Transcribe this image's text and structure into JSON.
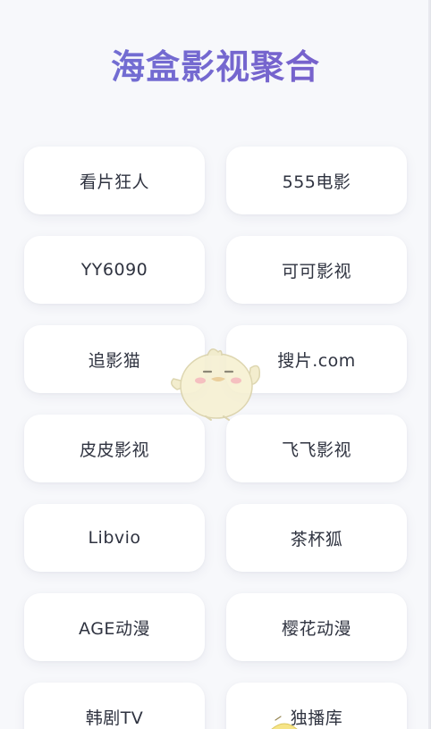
{
  "header": {
    "title": "海盒影视聚合"
  },
  "sites": [
    {
      "label": "看片狂人"
    },
    {
      "label": "555电影"
    },
    {
      "label": "YY6090"
    },
    {
      "label": "可可影视"
    },
    {
      "label": "追影猫"
    },
    {
      "label": "搜片.com"
    },
    {
      "label": "皮皮影视"
    },
    {
      "label": "飞飞影视"
    },
    {
      "label": "Libvio"
    },
    {
      "label": "茶杯狐"
    },
    {
      "label": "AGE动漫"
    },
    {
      "label": "樱花动漫"
    },
    {
      "label": "韩剧TV"
    },
    {
      "label": "独播库"
    }
  ],
  "colors": {
    "title_gradient_start": "#6f73d6",
    "title_gradient_end": "#7a5cc9",
    "card_background": "#ffffff",
    "page_background": "#f7f8fb",
    "label_text": "#2f3340"
  },
  "icons": {
    "mascot": "yellow-chick-mascot-icon"
  }
}
